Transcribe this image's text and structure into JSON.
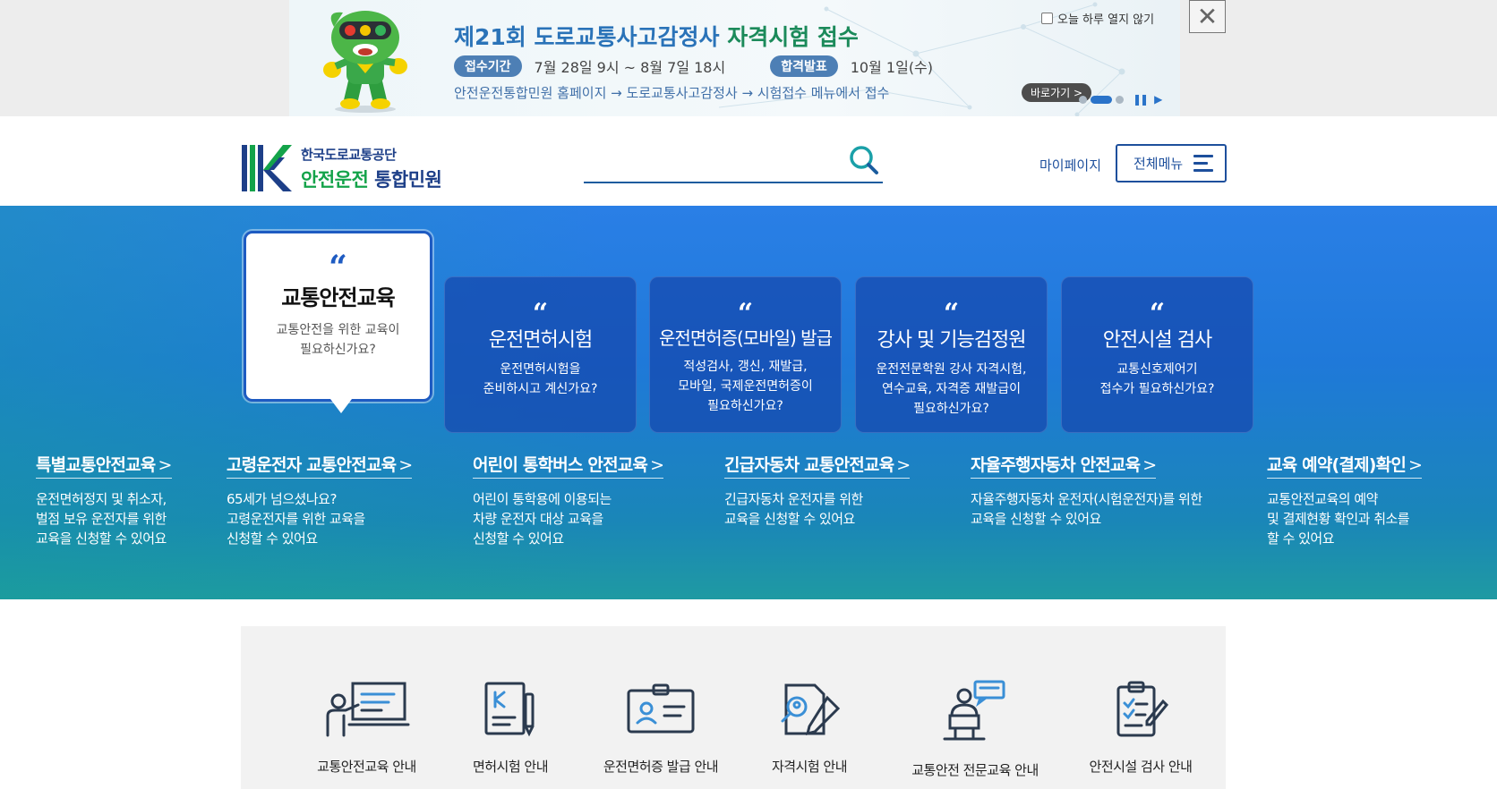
{
  "banner": {
    "title_prefix": "제21회 도로교통사고감정사 ",
    "title_highlight": "자격시험 접수",
    "period_label": "접수기간",
    "period_value": "7월 28일 9시 ~ 8월 7일 18시",
    "result_label": "합격발표",
    "result_value": "10월 1일(수)",
    "path_text": "안전운전통합민원 홈페이지 → 도로교통사고감정사 → 시험접수 메뉴에서 접수",
    "shortcut_label": "바로가기 >",
    "today_close_label": "오늘 하루 열지 않기",
    "close_label": "✕"
  },
  "header": {
    "logo_top": "한국도로교통공단",
    "logo_bottom_1": "안전운전 ",
    "logo_bottom_2": "통합민원",
    "search_value": "",
    "mypage_label": "마이페이지",
    "allmenu_label": "전체메뉴"
  },
  "cards": [
    {
      "quote": "“",
      "title": "교통안전교육",
      "desc_1": "교통안전을 위한 교육이",
      "desc_2": "필요하신가요?",
      "desc_3": ""
    },
    {
      "quote": "“",
      "title": "운전면허시험",
      "desc_1": "운전면허시험을",
      "desc_2": "준비하시고 계신가요?",
      "desc_3": ""
    },
    {
      "quote": "“",
      "title": "운전면허증(모바일) 발급",
      "desc_1": "적성검사, 갱신, 재발급,",
      "desc_2": "모바일, 국제운전면허증이",
      "desc_3": "필요하신가요?"
    },
    {
      "quote": "“",
      "title": "강사 및 기능검정원",
      "desc_1": "운전전문학원 강사 자격시험,",
      "desc_2": "연수교육, 자격증 재발급이",
      "desc_3": "필요하신가요?"
    },
    {
      "quote": "“",
      "title": "안전시설 검사",
      "desc_1": "교통신호제어기",
      "desc_2": "접수가 필요하신가요?",
      "desc_3": ""
    }
  ],
  "edu": [
    {
      "title": "특별교통안전교육",
      "arrow": ">",
      "d1": "운전면허정지 및 취소자,",
      "d2": "벌점 보유 운전자를 위한",
      "d3": "교육을 신청할 수 있어요"
    },
    {
      "title": "고령운전자 교통안전교육",
      "arrow": ">",
      "d1": "65세가 넘으셨나요?",
      "d2": "고령운전자를 위한 교육을",
      "d3": "신청할 수 있어요"
    },
    {
      "title": "어린이 통학버스 안전교육",
      "arrow": ">",
      "d1": "어린이 통학용에 이용되는",
      "d2": "차량 운전자 대상 교육을",
      "d3": "신청할 수 있어요"
    },
    {
      "title": "긴급자동차 교통안전교육",
      "arrow": ">",
      "d1": "긴급자동차 운전자를 위한",
      "d2": "교육을 신청할 수 있어요",
      "d3": ""
    },
    {
      "title": "자율주행자동차 안전교육",
      "arrow": ">",
      "d1": "자율주행자동차 운전자(시험운전자)를 위한",
      "d2": "교육을 신청할 수 있어요",
      "d3": ""
    },
    {
      "title": "교육 예약(결제)확인",
      "arrow": ">",
      "d1": "교통안전교육의 예약",
      "d2": "및 결제현황 확인과 취소를",
      "d3": "할 수 있어요"
    }
  ],
  "guide": [
    {
      "label": "교통안전교육 안내",
      "icon": "presentation-icon"
    },
    {
      "label": "면허시험 안내",
      "icon": "document-pen-icon"
    },
    {
      "label": "운전면허증 발급 안내",
      "icon": "id-card-icon"
    },
    {
      "label": "자격시험 안내",
      "icon": "magnifier-pen-icon"
    },
    {
      "label": "교통안전 전문교육 안내",
      "icon": "lecturer-icon"
    },
    {
      "label": "안전시설 검사 안내",
      "icon": "checklist-icon"
    }
  ],
  "colors": {
    "brand_blue": "#1d4f9c",
    "brand_green": "#14a34a",
    "hero_top": "#2a7fe6",
    "hero_bottom": "#1f9aa2",
    "card_active_border": "#1e5bc2"
  }
}
